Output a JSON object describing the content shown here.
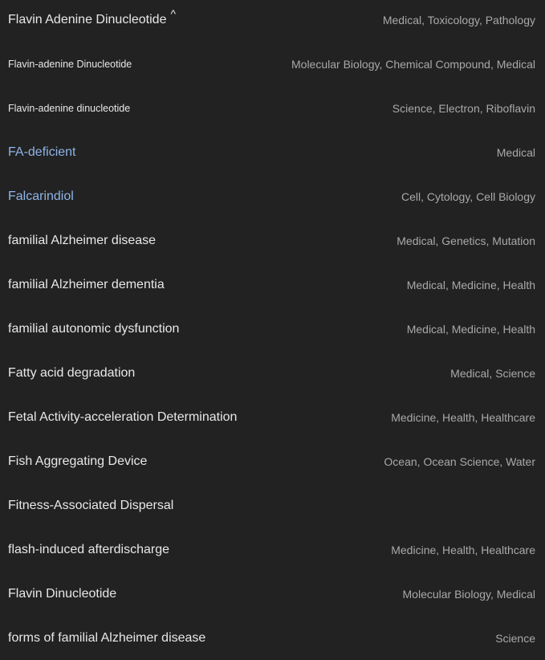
{
  "rows": [
    {
      "term": "Flavin Adenine Dinucleotide",
      "categories": "Medical, Toxicology, Pathology",
      "caret": "^"
    },
    {
      "term": "Flavin-adenine Dinucleotide",
      "categories": "Molecular Biology, Chemical Compound, Medical"
    },
    {
      "term": "Flavin-adenine dinucleotide",
      "categories": "Science, Electron, Riboflavin"
    },
    {
      "term": "FA-deficient",
      "categories": "Medical"
    },
    {
      "term": "Falcarindiol",
      "categories": "Cell, Cytology, Cell Biology"
    },
    {
      "term": "familial Alzheimer disease",
      "categories": "Medical, Genetics, Mutation"
    },
    {
      "term": "familial Alzheimer dementia",
      "categories": "Medical, Medicine, Health"
    },
    {
      "term": "familial autonomic dysfunction",
      "categories": "Medical, Medicine, Health"
    },
    {
      "term": "Fatty acid degradation",
      "categories": "Medical, Science"
    },
    {
      "term": "Fetal Activity-acceleration Determination",
      "categories": "Medicine, Health, Healthcare"
    },
    {
      "term": "Fish Aggregating Device",
      "categories": "Ocean, Ocean Science, Water"
    },
    {
      "term": "Fitness-Associated Dispersal",
      "categories": ""
    },
    {
      "term": "flash-induced afterdischarge",
      "categories": "Medicine, Health, Healthcare"
    },
    {
      "term": "Flavin Dinucleotide",
      "categories": "Molecular Biology, Medical"
    },
    {
      "term": "forms of familial Alzheimer disease",
      "categories": "Science"
    }
  ],
  "colors": {
    "background": "#222222",
    "term_text": "#e8e8e8",
    "link_text": "#8fb4e8",
    "category_text": "#a9a9a9"
  }
}
